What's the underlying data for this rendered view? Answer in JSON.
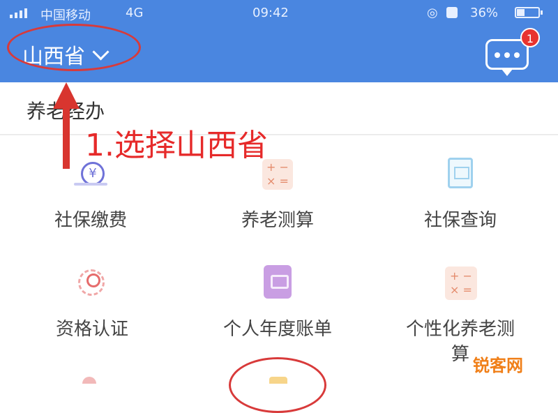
{
  "status_bar": {
    "carrier": "中国移动",
    "network": "4G",
    "time": "09:42",
    "battery": "36%",
    "icons": [
      "signal-icon",
      "alarm-icon",
      "lock-icon",
      "battery-icon"
    ]
  },
  "header": {
    "province": "山西省",
    "message_badge": "1",
    "background": "#4a86e0"
  },
  "section": {
    "title": "养老经办"
  },
  "annotation": {
    "text": "1.选择山西省",
    "color": "#e62a2a"
  },
  "grid": [
    {
      "label": "社保缴费",
      "icon": "coin-icon"
    },
    {
      "label": "养老测算",
      "icon": "calculator-icon"
    },
    {
      "label": "社保查询",
      "icon": "bank-icon"
    },
    {
      "label": "资格认证",
      "icon": "person-verify-icon"
    },
    {
      "label": "个人年度账单",
      "icon": "bill-icon"
    },
    {
      "label": "个性化养老测算",
      "icon": "calculator-icon"
    }
  ],
  "watermark": "锐客网"
}
